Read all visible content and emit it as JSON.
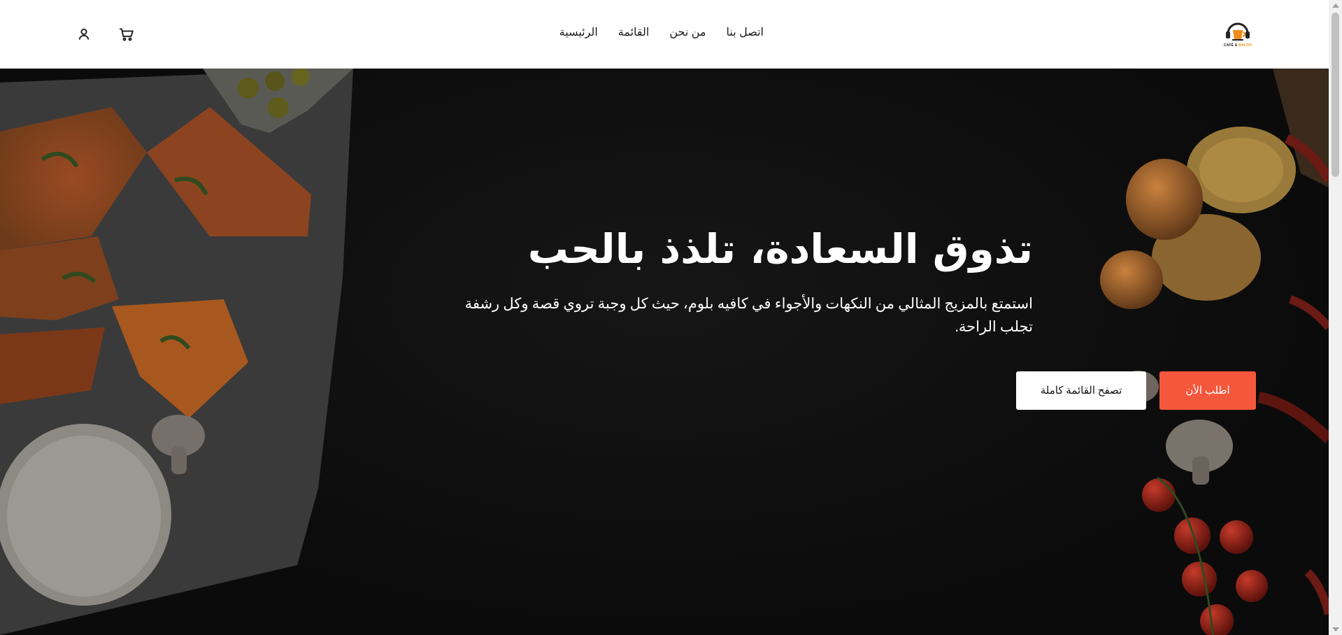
{
  "header": {
    "nav": [
      {
        "label": "الرئيسية"
      },
      {
        "label": "القائمة"
      },
      {
        "label": "من نحن"
      },
      {
        "label": "اتصل بنا"
      }
    ],
    "logo": {
      "text_main": "CAFÉ &",
      "text_accent": "BALOO"
    },
    "icons": {
      "user": "user-icon",
      "cart": "cart-icon"
    }
  },
  "hero": {
    "title": "تذوق السعادة، تلذذ بالحب",
    "subtitle": "استمتع بالمزيج المثالي من النكهات والأجواء في كافيه بلوم، حيث كل وجبة تروي قصة وكل رشفة تجلب الراحة.",
    "order_button": "اطلب الأن",
    "menu_button": "تصفح القائمة كاملة"
  },
  "colors": {
    "accent": "#f4573c",
    "logo_accent": "#f08a1c",
    "hero_bg": "#0e0e0e",
    "header_bg": "#ffffff"
  }
}
